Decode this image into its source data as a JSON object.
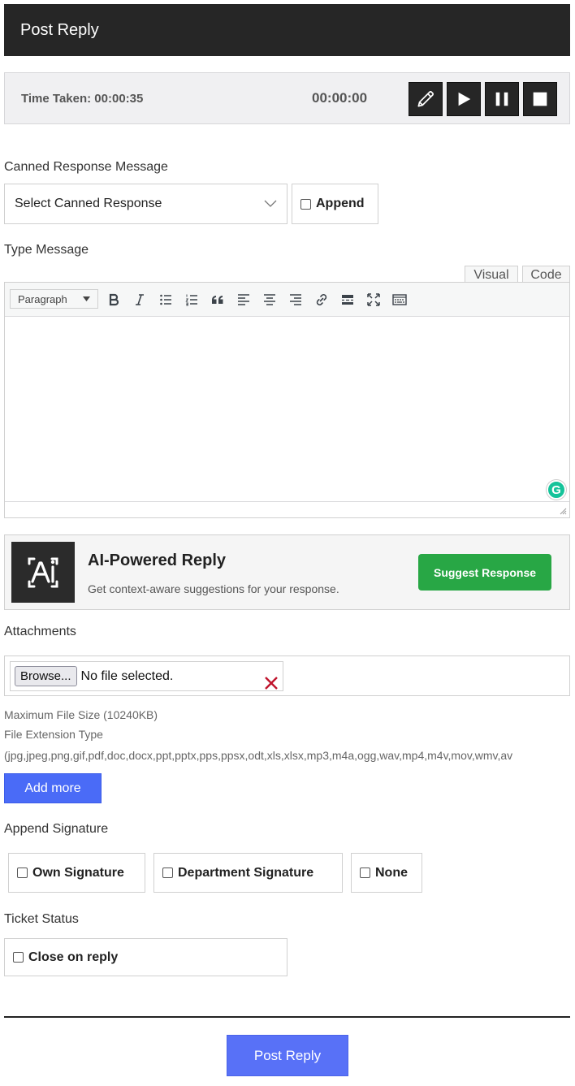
{
  "header": {
    "title": "Post Reply"
  },
  "timer": {
    "time_taken": "Time Taken: 00:00:35",
    "clock": "00:00:00",
    "buttons": [
      "pencil-icon",
      "play-icon",
      "pause-icon",
      "stop-icon"
    ]
  },
  "canned": {
    "label": "Canned Response Message",
    "select_value": "Select Canned Response",
    "append_label": "Append"
  },
  "message": {
    "label": "Type Message",
    "tabs": [
      "Visual",
      "Code"
    ],
    "format_value": "Paragraph",
    "toolbar_icons": [
      "bold-icon",
      "italic-icon",
      "bullet-list-icon",
      "numbered-list-icon",
      "blockquote-icon",
      "align-left-icon",
      "align-center-icon",
      "align-right-icon",
      "link-icon",
      "read-more-icon",
      "fullscreen-icon",
      "toolbar-toggle-icon"
    ],
    "grammarly_letter": "G"
  },
  "ai": {
    "title": "AI-Powered Reply",
    "description": "Get context-aware suggestions for your response.",
    "button_label": "Suggest Response"
  },
  "attachments": {
    "label": "Attachments",
    "browse_label": "Browse...",
    "no_file": "No file selected.",
    "max_size": "Maximum File Size (10240KB)",
    "ext_label": "File Extension Type",
    "extensions": "(jpg,jpeg,png,gif,pdf,doc,docx,ppt,pptx,pps,ppsx,odt,xls,xlsx,mp3,m4a,ogg,wav,mp4,m4v,mov,wmv,av",
    "add_more_label": "Add more"
  },
  "signature": {
    "label": "Append Signature",
    "options": [
      "Own Signature",
      "Department Signature",
      "None"
    ]
  },
  "status": {
    "label": "Ticket Status",
    "close_label": "Close on reply"
  },
  "submit": {
    "label": "Post Reply"
  },
  "colors": {
    "header_bg": "#262626",
    "primary": "#5871f7",
    "success": "#28a745",
    "danger": "#c0142c"
  }
}
